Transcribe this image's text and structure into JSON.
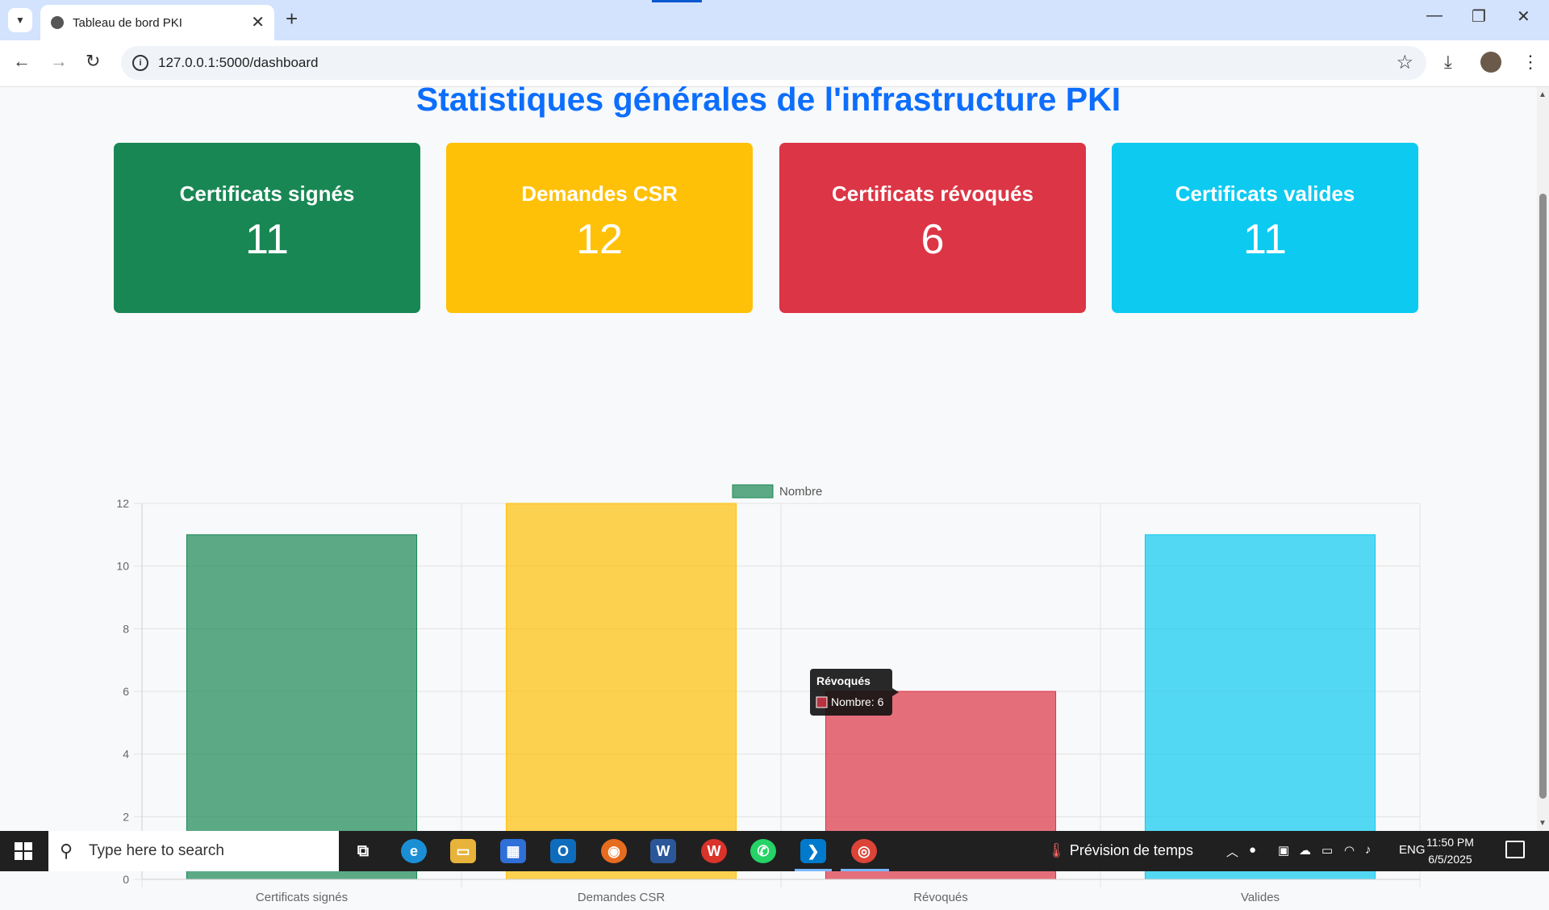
{
  "browser": {
    "tab_title": "Tableau de bord PKI",
    "url": "127.0.0.1:5000/dashboard"
  },
  "page": {
    "title": "Statistiques générales de l'infrastructure PKI",
    "cards": [
      {
        "label": "Certificats signés",
        "value": "11",
        "color": "#198754"
      },
      {
        "label": "Demandes CSR",
        "value": "12",
        "color": "#ffc107"
      },
      {
        "label": "Certificats révoqués",
        "value": "6",
        "color": "#dc3545"
      },
      {
        "label": "Certificats valides",
        "value": "11",
        "color": "#0dcaf0"
      }
    ]
  },
  "chart_data": {
    "type": "bar",
    "categories": [
      "Certificats signés",
      "Demandes CSR",
      "Révoqués",
      "Valides"
    ],
    "series": [
      {
        "name": "Nombre",
        "values": [
          11,
          12,
          6,
          11
        ]
      }
    ],
    "colors": [
      "#198754",
      "#ffc107",
      "#dc3545",
      "#0dcaf0"
    ],
    "ylim": [
      0,
      12
    ],
    "yticks": [
      0,
      2,
      4,
      6,
      8,
      10,
      12
    ],
    "grid": true,
    "legend": "top-center",
    "tooltip": {
      "title": "Révoqués",
      "text": "Nombre: 6"
    }
  },
  "taskbar": {
    "search_placeholder": "Type here to search",
    "weather": "Prévision de temps",
    "language": "ENG",
    "time": "11:50 PM",
    "date": "6/5/2025"
  }
}
